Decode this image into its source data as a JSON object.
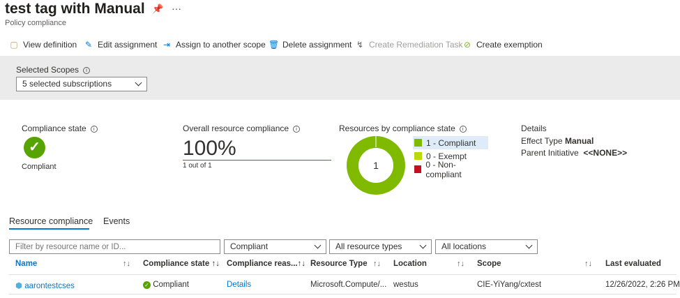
{
  "header": {
    "title": "test tag with Manual",
    "subtitle": "Policy compliance",
    "pin_icon": "pin-icon",
    "more_label": "···"
  },
  "toolbar": [
    {
      "label": "View definition",
      "icon": "document-icon",
      "disabled": false
    },
    {
      "label": "Edit assignment",
      "icon": "pencil-icon",
      "disabled": false
    },
    {
      "label": "Assign to another scope",
      "icon": "assign-arrow-icon",
      "disabled": false
    },
    {
      "label": "Delete assignment",
      "icon": "trash-icon",
      "disabled": false
    },
    {
      "label": "Create Remediation Task",
      "icon": "remediation-icon",
      "disabled": true
    },
    {
      "label": "Create exemption",
      "icon": "exemption-icon",
      "disabled": false
    }
  ],
  "scopes": {
    "label": "Selected Scopes",
    "value": "5 selected subscriptions"
  },
  "summary": {
    "compliance_state_label": "Compliance state",
    "compliance_state": "Compliant",
    "overall_label": "Overall resource compliance",
    "overall_value": "100%",
    "overall_detail": "1 out of 1",
    "by_state_label": "Resources by compliance state",
    "donut_center": "1",
    "legend": [
      {
        "label": "1 - Compliant",
        "color": "#7fba00",
        "value": 1
      },
      {
        "label": "0 - Exempt",
        "color": "#bad80a",
        "value": 0
      },
      {
        "label": "0 - Non-compliant",
        "color": "#c50f1f",
        "value": 0
      }
    ],
    "details_label": "Details",
    "effect_type_label": "Effect Type",
    "effect_type": "Manual",
    "parent_initiative_label": "Parent Initiative",
    "parent_initiative": "<<NONE>>"
  },
  "tabs": [
    {
      "label": "Resource compliance",
      "active": true
    },
    {
      "label": "Events",
      "active": false
    }
  ],
  "filters": {
    "search_placeholder": "Filter by resource name or ID...",
    "state": "Compliant",
    "types": "All resource types",
    "locations": "All locations"
  },
  "table": {
    "columns": [
      "Name",
      "Compliance state",
      "Compliance reas...",
      "Resource Type",
      "Location",
      "Scope",
      "Last evaluated"
    ],
    "rows": [
      {
        "name": "aarontestcses",
        "state": "Compliant",
        "reason": "Details",
        "type": "Microsoft.Compute/...",
        "location": "westus",
        "scope": "CIE-YiYang/cxtest",
        "last": "12/26/2022, 2:26 PM"
      }
    ]
  }
}
